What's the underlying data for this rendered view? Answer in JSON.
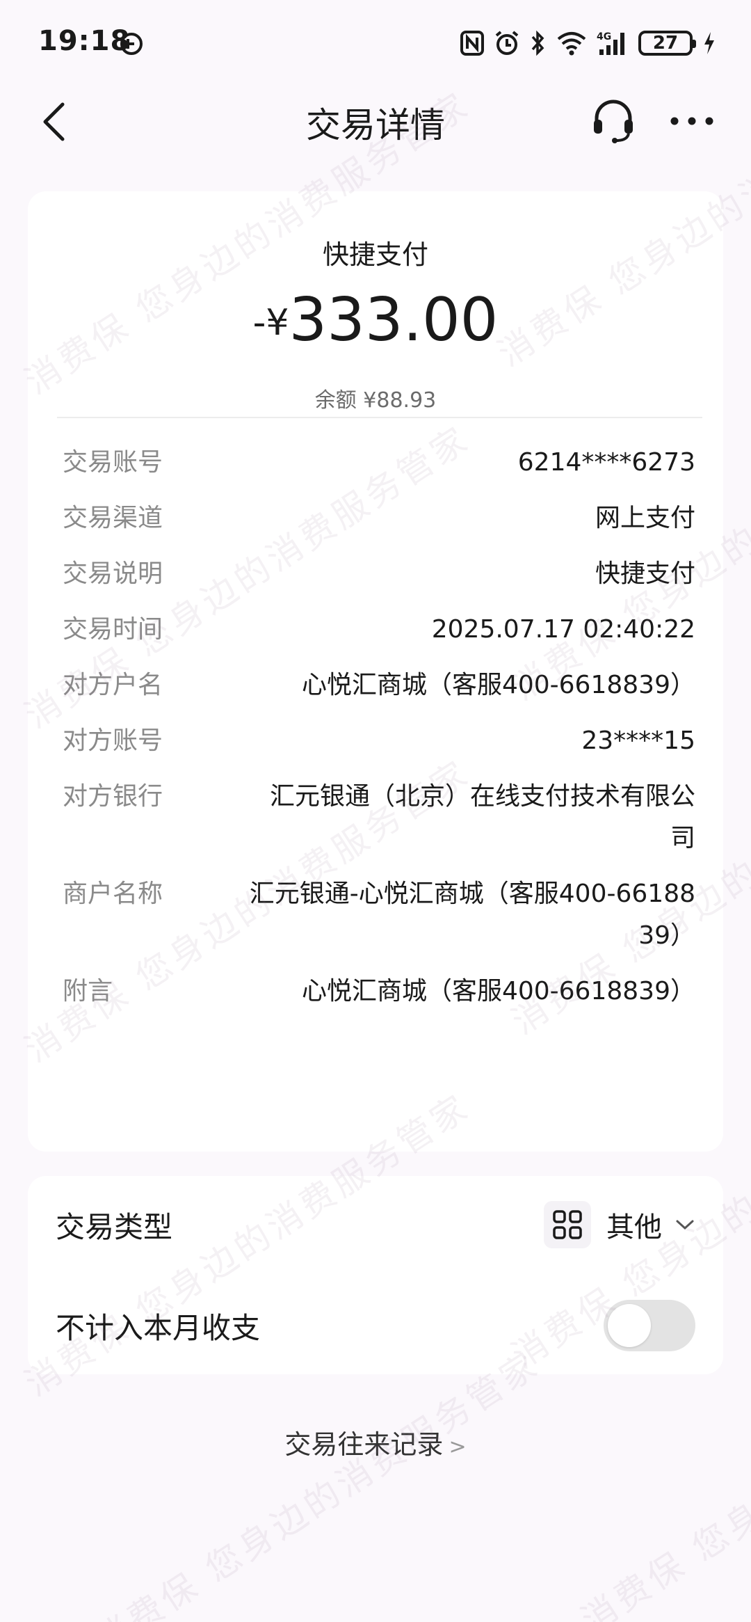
{
  "status_bar": {
    "time": "19:18",
    "battery_level": "27",
    "icons": [
      "clock-badge-icon",
      "nfc-icon",
      "alarm-icon",
      "bluetooth-icon",
      "wifi-icon",
      "cellular-4g-icon",
      "battery-icon",
      "charging-bolt-icon"
    ]
  },
  "nav": {
    "title": "交易详情"
  },
  "watermark": {
    "text": "消费保 您身边的消费服务管家"
  },
  "transaction": {
    "type": "快捷支付",
    "amount_prefix": "-¥",
    "amount": "333.00",
    "balance": "余额 ¥88.93"
  },
  "details": [
    {
      "label": "交易账号",
      "value": "6214****6273"
    },
    {
      "label": "交易渠道",
      "value": "网上支付"
    },
    {
      "label": "交易说明",
      "value": "快捷支付"
    },
    {
      "label": "交易时间",
      "value": "2025.07.17 02:40:22"
    },
    {
      "label": "对方户名",
      "value": "心悦汇商城（客服400-6618839）"
    },
    {
      "label": "对方账号",
      "value": "23****15"
    },
    {
      "label": "对方银行",
      "value": "汇元银通（北京）在线支付技术有限公司"
    },
    {
      "label": "商户名称",
      "value": "汇元银通-心悦汇商城（客服400-6618839）"
    },
    {
      "label": "附言",
      "value": "心悦汇商城（客服400-6618839）"
    }
  ],
  "settings": {
    "type_label": "交易类型",
    "type_value": "其他",
    "exclude_label": "不计入本月收支",
    "exclude_enabled": false
  },
  "history_link": {
    "label": "交易往来记录",
    "chevron": ">"
  },
  "colors": {
    "page_background": "#fbf8fc",
    "card_background": "#ffffff",
    "label_gray": "#8a8a8a",
    "text_dark": "#1a1a1a",
    "toggle_off": "#e3e3e3"
  }
}
